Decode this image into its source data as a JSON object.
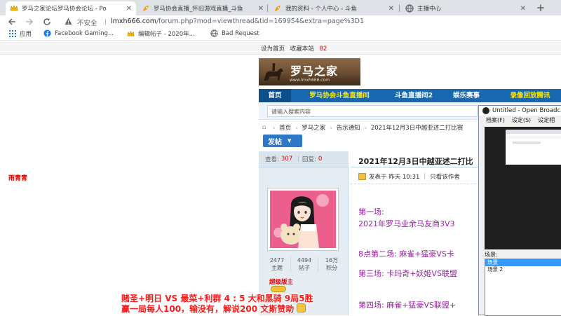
{
  "browser": {
    "tabs": [
      {
        "title": "罗马之家论坛罗马协会论坛 - Po",
        "icon": "crown-icon",
        "active": true
      },
      {
        "title": "罗马协会直播_怀旧游戏直播_斗鱼",
        "icon": "douyu-icon",
        "active": false
      },
      {
        "title": "我的资料 - 个人中心 - 斗鱼",
        "icon": "douyu-icon",
        "active": false
      },
      {
        "title": "主播中心",
        "icon": "globe-icon",
        "active": false
      }
    ],
    "security_label": "不安全",
    "url_host": "lmxh666.com",
    "url_path": "/forum.php?mod=viewthread&tid=169954&extra=page%3D1",
    "bookmarks": [
      {
        "label": "应用",
        "icon": "apps-grid-icon"
      },
      {
        "label": "Facebook Gaming...",
        "icon": "facebook-icon"
      },
      {
        "label": "编辑帖子 - 2020年...",
        "icon": "crown-icon"
      },
      {
        "label": "Bad Request",
        "icon": "globe-icon"
      }
    ]
  },
  "site": {
    "toplinks": {
      "set_home": "设为首页",
      "bookmark": "收藏本站",
      "count": "82"
    },
    "logo_text": "罗马之家",
    "logo_url": "www.lmxh666.com",
    "nav": [
      "首页",
      "罗马协会斗鱼直播间",
      "斗鱼直播间2",
      "娱乐赛事",
      "录像回放腾讯"
    ],
    "search_placeholder": "请输入搜索内容",
    "breadcrumb": [
      "首页",
      "罗马之家",
      "告示通知",
      "2021年12月3日中越亚述二打比赛"
    ],
    "post_button": "发帖"
  },
  "thread": {
    "views_label": "查看:",
    "views": "307",
    "replies_label": "回复:",
    "replies": "0",
    "author": "雨青青",
    "user_stats": [
      {
        "value": "2477",
        "label": "主题"
      },
      {
        "value": "4494",
        "label": "帖子"
      },
      {
        "value": "16万",
        "label": "积分"
      }
    ],
    "rank": "超级版主",
    "title": "2021年12月3日中越亚述二打比",
    "posted": "发表于 昨天 10:31",
    "author_only": "只看该作者",
    "lines": [
      "第一场:",
      "2021年罗马业余马友商3V3",
      "8点第二场: 麻雀+猛豪VS卡",
      "第三场: 卡玛奇+妖姬VS联盟",
      "第四场: 麻雀+猛豪VS联盟+"
    ]
  },
  "obs": {
    "title": "Untitled - Open Broadcaster",
    "menu": [
      "档案(F)",
      "设定(S)",
      "设定相"
    ],
    "scene_label": "场景:",
    "scenes": [
      "场景",
      "场景 2"
    ]
  },
  "overlay": {
    "line1": "赌圣+明日  VS  最菜+利群   4 : 5  大和黑骑 9局5胜",
    "line2": "赢一局每人100，输没有，解说200  文斯赞助"
  }
}
